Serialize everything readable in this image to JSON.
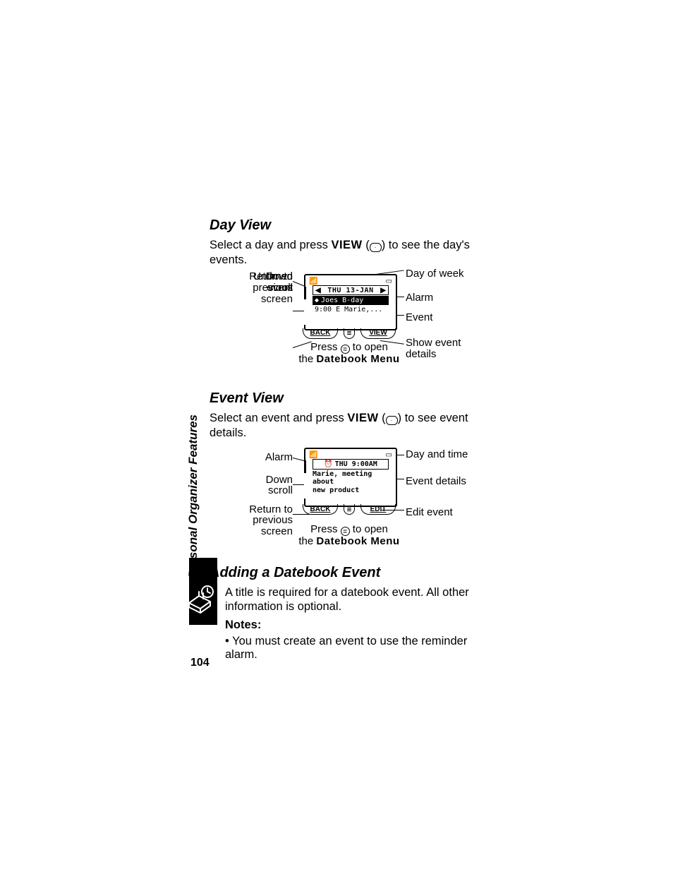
{
  "sidebarLabel": "Personal Organizer Features",
  "pageNumber": "104",
  "dayView": {
    "heading": "Day View",
    "intro_a": "Select a day and press ",
    "intro_key": "VIEW",
    "intro_b": ") to see the day's events.",
    "callouts_left": [
      "Untimed\nevent",
      "Down\nscroll",
      "Return to\nprevious\nscreen"
    ],
    "callouts_right": [
      "Day of week",
      "Alarm",
      "Event",
      "Show event\ndetails"
    ],
    "screen": {
      "date": "THU 13-JAN",
      "row1": "Joes B-day",
      "row2": "9:00 E Marie,...",
      "soft_left": "BACK",
      "soft_right": "VIEW"
    },
    "press_a": "Press ",
    "press_b": " to open",
    "press_c": "the ",
    "press_menu": "Datebook Menu"
  },
  "eventView": {
    "heading": "Event View",
    "intro_a": "Select an event and press ",
    "intro_key": "VIEW",
    "intro_b": ") to see event details.",
    "callouts_left": [
      "Alarm",
      "Down\nscroll",
      "Return to\nprevious\nscreen"
    ],
    "callouts_right": [
      "Day and time",
      "Event details",
      "Edit event"
    ],
    "screen": {
      "date": "THU 9:00AM",
      "line1": "Marie, meeting about",
      "line2": "new product",
      "soft_left": "BACK",
      "soft_right": "EDIT"
    },
    "press_a": "Press ",
    "press_b": " to open",
    "press_c": "the ",
    "press_menu": "Datebook Menu"
  },
  "addEvent": {
    "heading": "Adding a Datebook Event",
    "para": "A title is required for a datebook event. All other information is optional.",
    "notes_label": "Notes:",
    "notes": [
      "You must create an event to use the reminder alarm."
    ]
  }
}
